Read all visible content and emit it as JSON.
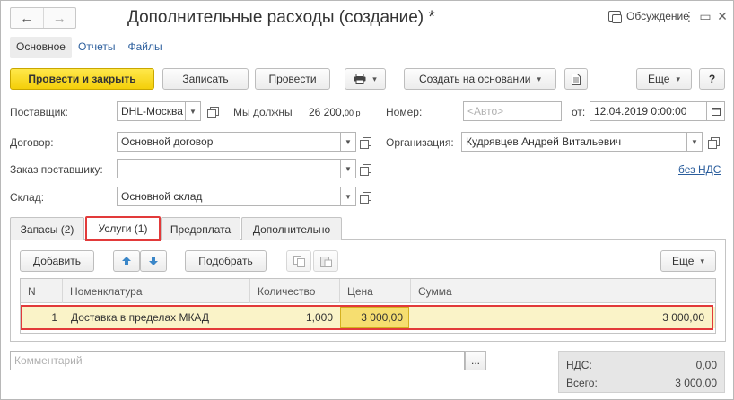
{
  "window": {
    "title": "Дополнительные расходы (создание) *",
    "discussion": "Обсуждение",
    "nav_back": "←",
    "nav_forward": "→",
    "menu_icon": "⋮",
    "restore_icon": "▭",
    "close_icon": "✕"
  },
  "sections": [
    {
      "label": "Основное",
      "active": true
    },
    {
      "label": "Отчеты"
    },
    {
      "label": "Файлы"
    }
  ],
  "toolbar": {
    "post_close": "Провести и закрыть",
    "save": "Записать",
    "post": "Провести",
    "print_icon": "printer-icon",
    "create_based": "Создать на основании",
    "more": "Еще",
    "help": "?"
  },
  "form": {
    "supplier_label": "Поставщик:",
    "supplier_value": "DHL-Москва",
    "owe_label": "Мы должны",
    "owe_amount": "26 200,",
    "owe_currency": "00 р",
    "number_label": "Номер:",
    "number_placeholder": "<Авто>",
    "from_label": "от:",
    "date_value": "12.04.2019  0:00:00",
    "contract_label": "Договор:",
    "contract_value": "Основной договор",
    "org_label": "Организация:",
    "org_value": "Кудрявцев Андрей Витальевич",
    "order_label": "Заказ поставщику:",
    "order_value": "",
    "vat_link": "без НДС",
    "warehouse_label": "Склад:",
    "warehouse_value": "Основной склад"
  },
  "tabs": [
    {
      "label": "Запасы (2)"
    },
    {
      "label": "Услуги (1)",
      "active": true
    },
    {
      "label": "Предоплата"
    },
    {
      "label": "Дополнительно"
    }
  ],
  "table_toolbar": {
    "add": "Добавить",
    "up_icon": "arrow-up-icon",
    "down_icon": "arrow-down-icon",
    "select": "Подобрать",
    "more": "Еще"
  },
  "table": {
    "columns": [
      "N",
      "Номенклатура",
      "Количество",
      "Цена",
      "Сумма"
    ],
    "rows": [
      {
        "n": "1",
        "item": "Доставка в пределах МКАД",
        "qty": "1,000",
        "price": "3 000,00",
        "sum": "3 000,00"
      }
    ]
  },
  "footer": {
    "comment_placeholder": "Комментарий",
    "comment_btn": "...",
    "vat_label": "НДС:",
    "vat_value": "0,00",
    "total_label": "Всего:",
    "total_value": "3 000,00"
  },
  "colors": {
    "primary_button": "#f4cf0a",
    "link": "#2a5d9c",
    "highlight": "#e23a3a",
    "selected_row": "#faf3c8"
  }
}
